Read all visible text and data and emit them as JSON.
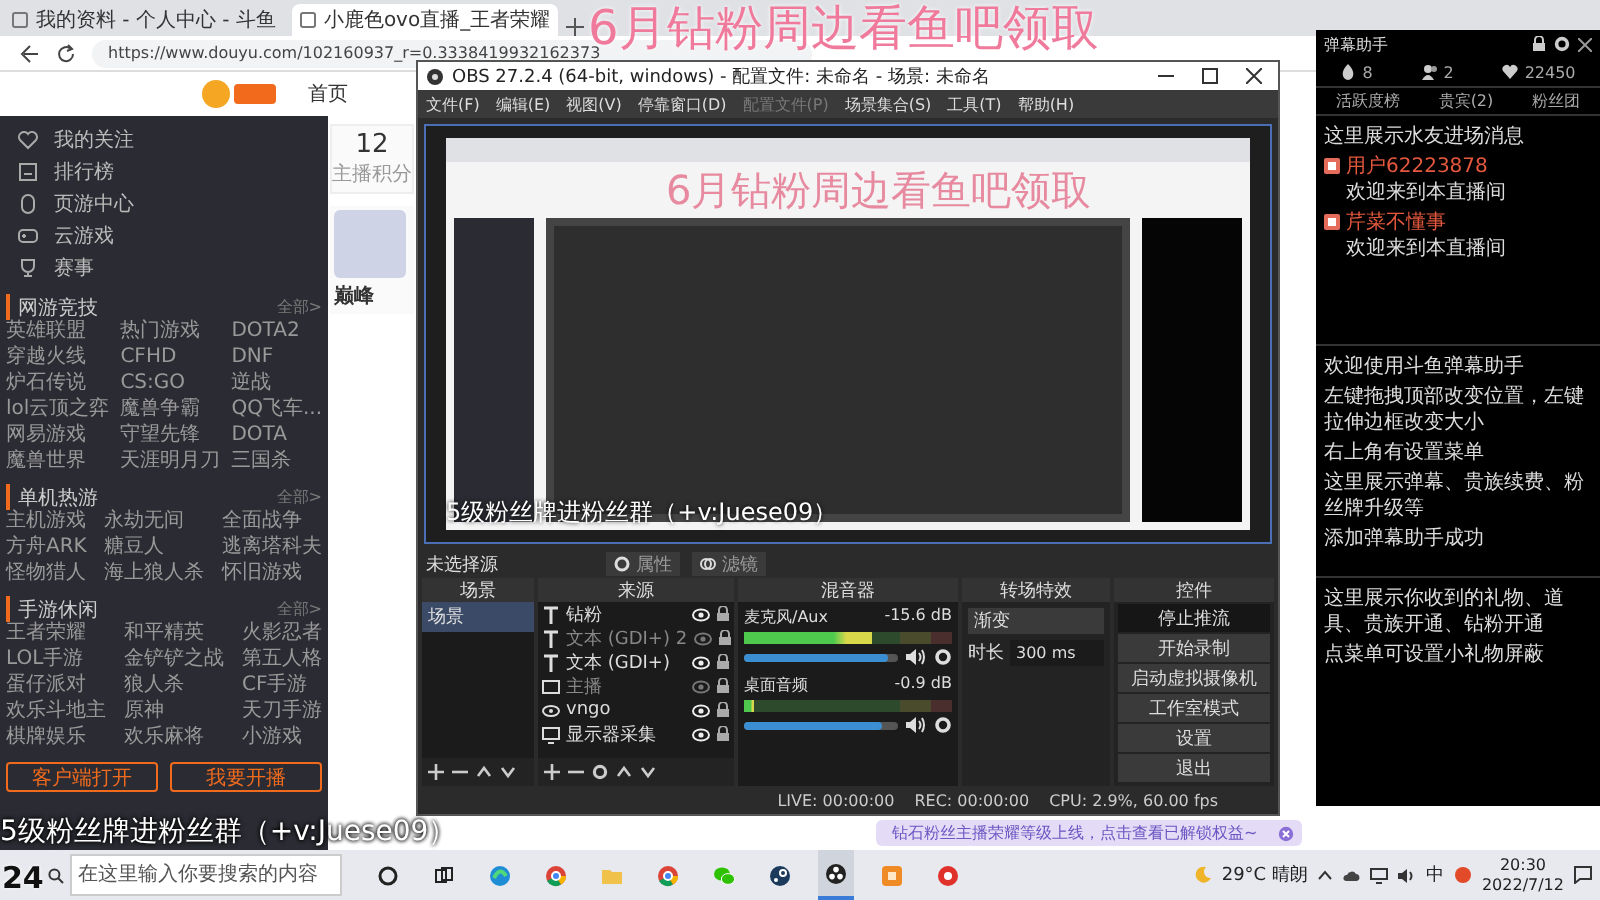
{
  "browser": {
    "tabs": [
      {
        "title": "我的资料 - 个人中心 - 斗鱼",
        "selected": false
      },
      {
        "title": "小鹿色ovo直播_王者荣耀",
        "selected": true
      }
    ],
    "address": "https://www.douyu.com/102160937_r=0.3338419932162373",
    "nav": [
      "首页"
    ],
    "sidebar": {
      "items": [
        {
          "kind": "heart",
          "label": "我的关注"
        },
        {
          "kind": "rank",
          "label": "排行榜"
        },
        {
          "kind": "mouse",
          "label": "页游中心"
        },
        {
          "kind": "pad",
          "label": "云游戏"
        },
        {
          "kind": "trophy",
          "label": "赛事"
        }
      ],
      "sections": [
        {
          "title": "网游竞技",
          "more": "全部>",
          "games": [
            "英雄联盟",
            "热门游戏",
            "DOTA2",
            "穿越火线",
            "CFHD",
            "DNF",
            "炉石传说",
            "CS:GO",
            "逆战",
            "lol云顶之弈",
            "魔兽争霸",
            "QQ飞车...",
            "网易游戏",
            "守望先锋",
            "DOTA",
            "魔兽世界",
            "天涯明月刀",
            "三国杀"
          ]
        },
        {
          "title": "单机热游",
          "more": "全部>",
          "games": [
            "主机游戏",
            "永劫无间",
            "全面战争",
            "方舟ARK",
            "糖豆人",
            "逃离塔科夫",
            "怪物猎人",
            "海上狼人杀",
            "怀旧游戏"
          ]
        },
        {
          "title": "手游休闲",
          "more": "全部>",
          "games": [
            "王者荣耀",
            "和平精英",
            "火影忍者",
            "LOL手游",
            "金铲铲之战",
            "第五人格",
            "蛋仔派对",
            "狼人杀",
            "CF手游",
            "欢乐斗地主",
            "原神",
            "天刀手游",
            "棋牌娱乐",
            "欢乐麻将",
            "小游戏"
          ]
        }
      ],
      "buttons": [
        "客户端打开",
        "我要开播"
      ]
    },
    "cards": {
      "score": "12",
      "score_label": "主播积分",
      "streamer": "巅峰"
    }
  },
  "obs": {
    "title": "OBS 27.2.4 (64-bit, windows) - 配置文件: 未命名 - 场景: 未命名",
    "menu": [
      {
        "label": "文件(F)",
        "disabled": false
      },
      {
        "label": "编辑(E)",
        "disabled": false
      },
      {
        "label": "视图(V)",
        "disabled": false
      },
      {
        "label": "停靠窗口(D)",
        "disabled": false
      },
      {
        "label": "配置文件(P)",
        "disabled": true
      },
      {
        "label": "场景集合(S)",
        "disabled": false
      },
      {
        "label": "工具(T)",
        "disabled": false
      },
      {
        "label": "帮助(H)",
        "disabled": false
      }
    ],
    "preview": {
      "banner": "6月钻粉周边看鱼吧领取",
      "caption": "5级粉丝牌进粉丝群（+v:Juese09）"
    },
    "source_bar": {
      "label": "未选择源",
      "buttons": [
        "属性",
        "滤镜"
      ]
    },
    "scenes": {
      "title": "场景",
      "items": [
        {
          "name": "场景",
          "selected": true
        }
      ]
    },
    "sources": {
      "title": "来源",
      "items": [
        {
          "kind": "text",
          "name": "钻粉",
          "visible": true
        },
        {
          "kind": "text",
          "name": "文本 (GDI+) 2",
          "visible": false
        },
        {
          "kind": "text",
          "name": "文本 (GDI+)",
          "visible": true
        },
        {
          "kind": "image",
          "name": "主播",
          "visible": false
        },
        {
          "kind": "camera",
          "name": "vngo",
          "visible": true
        },
        {
          "kind": "display",
          "name": "显示器采集",
          "visible": true
        }
      ]
    },
    "mixer": {
      "title": "混音器",
      "channels": [
        {
          "name": "麦克风/Aux",
          "reading": "-15.6 dB",
          "meter": {
            "level": 0.62
          },
          "volume": {
            "level": 0.93
          }
        },
        {
          "name": "桌面音频",
          "reading": "-0.9 dB",
          "meter": {
            "level": 0.05
          },
          "volume": {
            "level": 0.9
          }
        }
      ]
    },
    "transitions": {
      "title": "转场特效",
      "effect": "渐变",
      "duration_label": "时长",
      "duration": "300 ms"
    },
    "controls": {
      "title": "控件",
      "buttons": [
        {
          "label": "停止推流",
          "active": true
        },
        {
          "label": "开始录制",
          "active": false
        },
        {
          "label": "启动虚拟摄像机",
          "active": false
        },
        {
          "label": "工作室模式",
          "active": false
        },
        {
          "label": "设置",
          "active": false
        },
        {
          "label": "退出",
          "active": false
        }
      ]
    },
    "status": [
      "LIVE: 00:00:00",
      "REC: 00:00:00",
      "CPU: 2.9%, 60.00 fps"
    ]
  },
  "toast": "钻石粉丝主播荣耀等级上线，点击查看已解锁权益~",
  "danmu": {
    "title": "弹幕助手",
    "stats": [
      {
        "kind": "fire",
        "value": "8"
      },
      {
        "kind": "people",
        "value": "2"
      },
      {
        "kind": "heart",
        "value": "22450"
      }
    ],
    "tabs": [
      "活跃度榜",
      "贵宾(2)",
      "粉丝团"
    ],
    "sections": [
      {
        "lines": [
          {
            "text": "这里展示水友进场消息"
          },
          {
            "user": "用户62223878",
            "text": "欢迎来到本直播间"
          },
          {
            "user": "芹菜不懂事",
            "text": "欢迎来到本直播间"
          }
        ]
      },
      {
        "lines": [
          {
            "text": "欢迎使用斗鱼弹幕助手"
          },
          {
            "text": "左键拖拽顶部改变位置，左键拉伸边框改变大小"
          },
          {
            "text": "右上角有设置菜单"
          },
          {
            "text": "这里展示弹幕、贵族续费、粉丝牌升级等"
          },
          {
            "text": "添加弹幕助手成功"
          }
        ]
      },
      {
        "lines": [
          {
            "text": "这里展示你收到的礼物、道具、贵族开通、钻粉开通"
          },
          {
            "text": "点菜单可设置小礼物屏蔽"
          }
        ]
      }
    ]
  },
  "overlay": {
    "banner": "6月钻粉周边看鱼吧领取",
    "caption": "5级粉丝牌进粉丝群（+v:Juese09）",
    "corner": "24"
  },
  "taskbar": {
    "search": {
      "placeholder": "在这里输入你要搜索的内容"
    },
    "apps": [
      {
        "kind": "circle"
      },
      {
        "kind": "taskview"
      },
      {
        "kind": "edge"
      },
      {
        "kind": "chrome"
      },
      {
        "kind": "folder"
      },
      {
        "kind": "chrome"
      },
      {
        "kind": "chat"
      },
      {
        "kind": "steam"
      },
      {
        "kind": "obs",
        "selected": true
      },
      {
        "kind": "orange"
      },
      {
        "kind": "red"
      }
    ],
    "weather": "29°C 晴朗",
    "ime": "中",
    "time": "20:30",
    "date": "2022/7/12"
  }
}
